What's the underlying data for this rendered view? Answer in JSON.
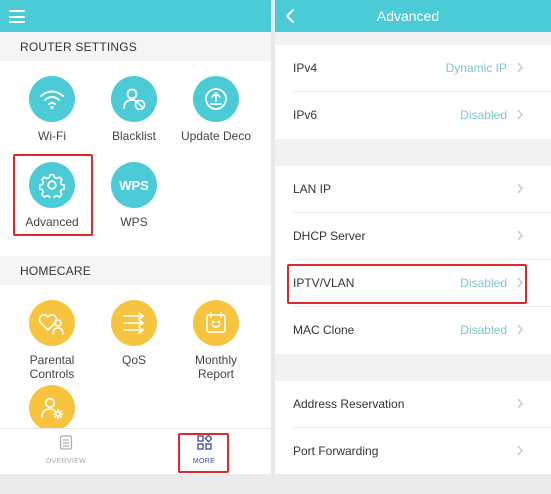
{
  "left": {
    "sections": {
      "router_settings": "ROUTER SETTINGS",
      "homecare": "HOMECARE"
    },
    "router_tiles": [
      {
        "label": "Wi-Fi",
        "icon": "wifi-icon"
      },
      {
        "label": "Blacklist",
        "icon": "blocked-user-icon"
      },
      {
        "label": "Update Deco",
        "icon": "upload-icon"
      },
      {
        "label": "Advanced",
        "icon": "gear-icon"
      },
      {
        "label": "WPS",
        "icon": "wps-icon",
        "icon_text": "WPS"
      }
    ],
    "homecare_tiles": [
      {
        "label": "Parental Controls",
        "line1": "Parental",
        "line2": "Controls",
        "icon": "family-icon"
      },
      {
        "label": "QoS",
        "icon": "qos-arrows-icon"
      },
      {
        "label": "Monthly Report",
        "line1": "Monthly",
        "line2": "Report",
        "icon": "calendar-report-icon"
      },
      {
        "label": "",
        "icon": "user-settings-icon"
      }
    ],
    "bottom_nav": [
      {
        "label": "OVERVIEW",
        "icon": "overview-icon"
      },
      {
        "label": "MORE",
        "icon": "more-grid-icon",
        "active": true
      }
    ]
  },
  "right": {
    "title": "Advanced",
    "groups": [
      [
        {
          "label": "IPv4",
          "value": "Dynamic IP"
        },
        {
          "label": "IPv6",
          "value": "Disabled"
        }
      ],
      [
        {
          "label": "LAN IP",
          "value": ""
        },
        {
          "label": "DHCP Server",
          "value": ""
        },
        {
          "label": "IPTV/VLAN",
          "value": "Disabled"
        },
        {
          "label": "MAC Clone",
          "value": "Disabled"
        }
      ],
      [
        {
          "label": "Address Reservation",
          "value": ""
        },
        {
          "label": "Port Forwarding",
          "value": ""
        }
      ]
    ]
  },
  "colors": {
    "accent": "#4acbd6",
    "homecare": "#f7c440",
    "highlight": "#e0282b",
    "value_text": "#7ec6cf",
    "nav_active": "#3a4a9a"
  }
}
